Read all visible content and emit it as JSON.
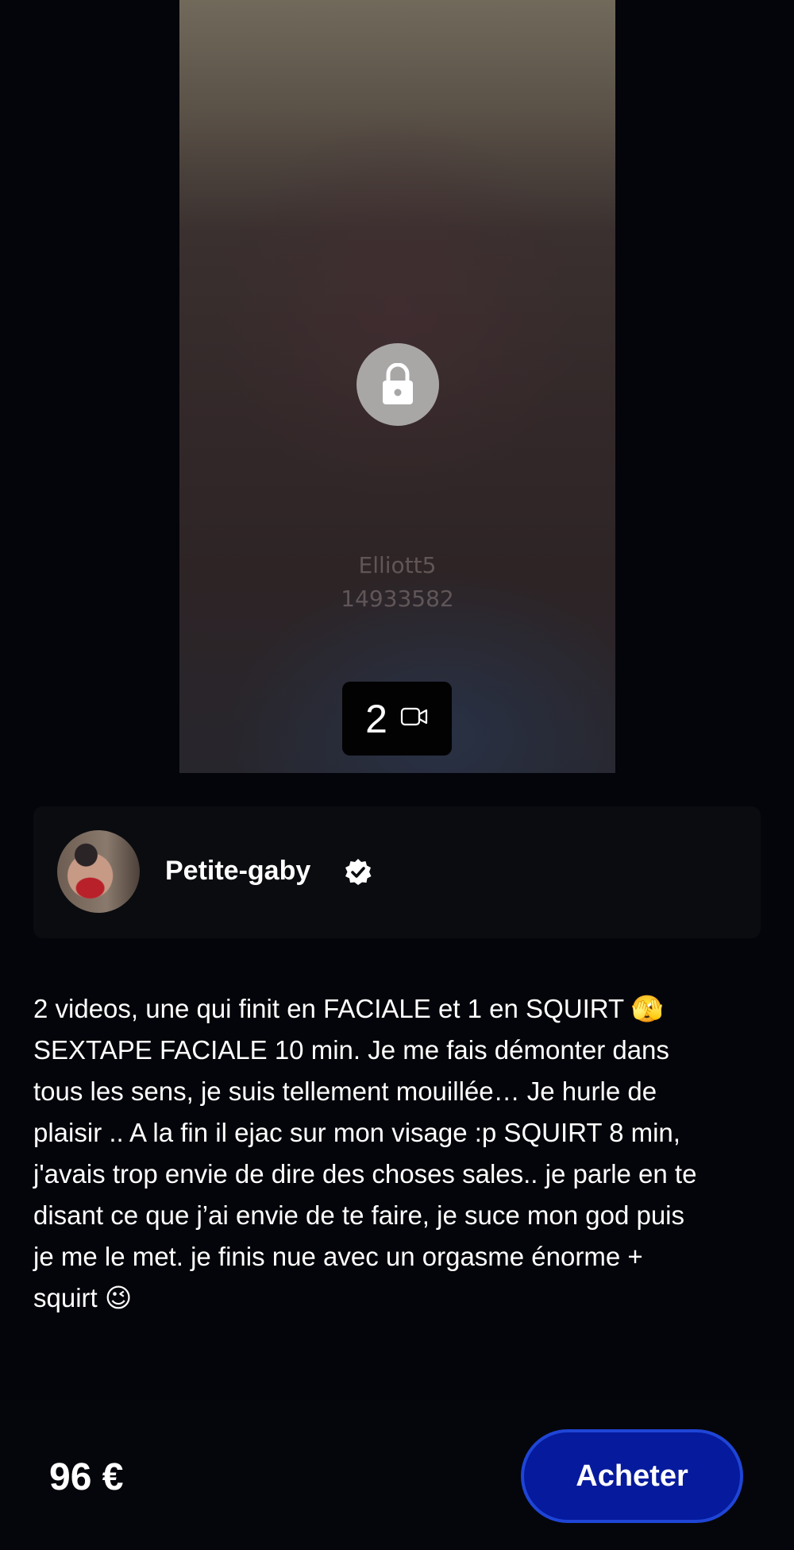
{
  "preview": {
    "watermark_name": "Elliott5",
    "watermark_id": "14933582",
    "media_count": "2",
    "lock_icon": "lock-icon",
    "media_icon": "video-camera-icon"
  },
  "creator": {
    "name": "Petite-gaby",
    "verified_icon": "verified-badge-icon"
  },
  "description": "2 videos, une qui finit en FACIALE et 1 en SQUIRT 🫣\nSEXTAPE FACIALE 10 min. Je me fais démonter dans\ntous les sens, je suis tellement mouillée… Je hurle de\nplaisir .. A la fin il ejac sur mon visage :p SQUIRT 8 min,\nj'avais trop envie de dire des choses sales.. je parle en te\ndisant ce que j’ai envie de te faire, je suce mon god puis\nje me le met. je finis nue avec un orgasme énorme +\nsquirt 😉",
  "purchase": {
    "price": "96 €",
    "buy_label": "Acheter"
  },
  "colors": {
    "background": "#04050a",
    "card": "#0b0c10",
    "button": "#051a9c",
    "button_border": "#1f45d6"
  }
}
